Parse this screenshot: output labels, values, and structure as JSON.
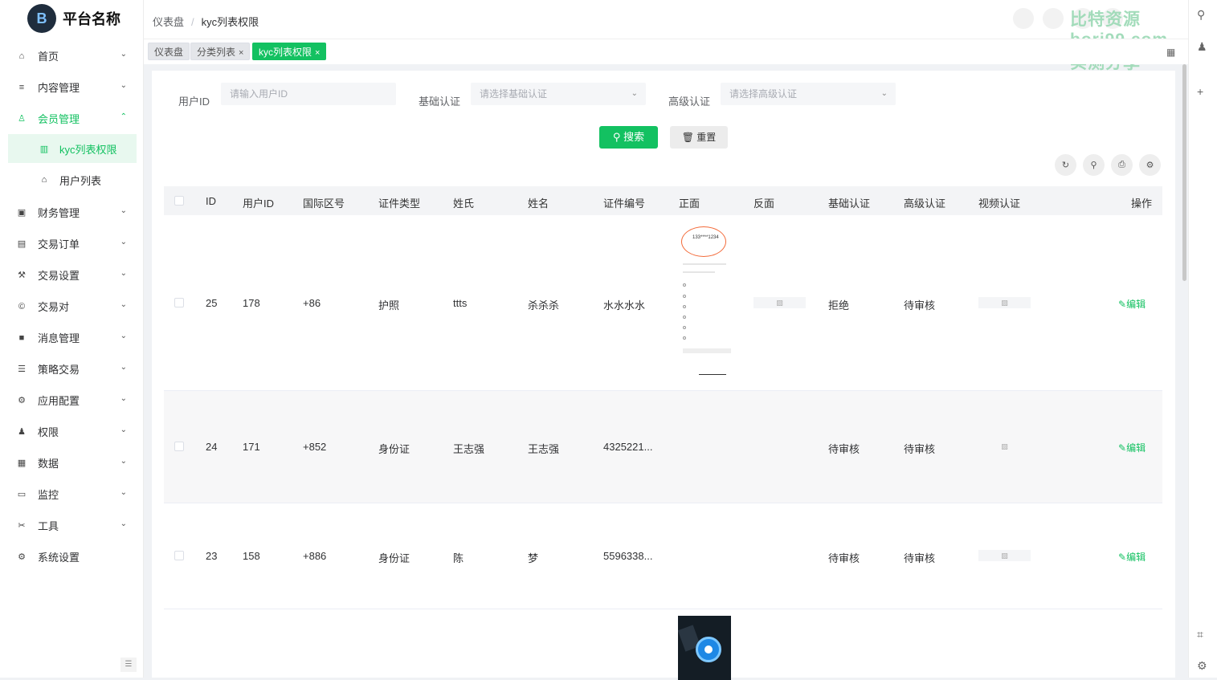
{
  "app": {
    "name": "平台名称",
    "logo_letter": "B"
  },
  "breadcrumb": {
    "items": [
      "仪表盘",
      "kyc列表权限"
    ],
    "separator": "/"
  },
  "watermark": "比特资源 bori99.com 实测分享",
  "tags": [
    {
      "label": "仪表盘",
      "closable": false,
      "active": false
    },
    {
      "label": "分类列表",
      "closable": true,
      "active": false
    },
    {
      "label": "kyc列表权限",
      "closable": true,
      "active": true
    }
  ],
  "close_glyph": "×",
  "sidebar": {
    "items": [
      {
        "label": "首页",
        "icon": "home-icon",
        "glyph": "⌂",
        "expanded": false
      },
      {
        "label": "内容管理",
        "icon": "list-icon",
        "glyph": "≡",
        "expanded": false
      },
      {
        "label": "会员管理",
        "icon": "user-icon",
        "glyph": "♙",
        "expanded": true,
        "active": true
      },
      {
        "label": "财务管理",
        "icon": "wallet-icon",
        "glyph": "▣",
        "expanded": false
      },
      {
        "label": "交易订单",
        "icon": "order-icon",
        "glyph": "▤",
        "expanded": false
      },
      {
        "label": "交易设置",
        "icon": "wrench-icon",
        "glyph": "⚒",
        "expanded": false
      },
      {
        "label": "交易对",
        "icon": "coin-icon",
        "glyph": "©",
        "expanded": false
      },
      {
        "label": "消息管理",
        "icon": "message-icon",
        "glyph": "■",
        "expanded": false
      },
      {
        "label": "策略交易",
        "icon": "menu-icon",
        "glyph": "☰",
        "expanded": false
      },
      {
        "label": "应用配置",
        "icon": "app-config-icon",
        "glyph": "⚙",
        "expanded": false
      },
      {
        "label": "权限",
        "icon": "permission-icon",
        "glyph": "♟",
        "expanded": false
      },
      {
        "label": "数据",
        "icon": "data-icon",
        "glyph": "▦",
        "expanded": false
      },
      {
        "label": "监控",
        "icon": "monitor-icon",
        "glyph": "▭",
        "expanded": false
      },
      {
        "label": "工具",
        "icon": "tools-icon",
        "glyph": "✂",
        "expanded": false
      },
      {
        "label": "系统设置",
        "icon": "settings-icon",
        "glyph": "⚙",
        "expanded": null
      }
    ],
    "sub_items": [
      {
        "label": "kyc列表权限",
        "icon": "book-icon",
        "glyph": "▥",
        "selected": true
      },
      {
        "label": "用户列表",
        "icon": "home-icon",
        "glyph": "⌂",
        "selected": false
      }
    ],
    "chevron_down": "⌄",
    "chevron_up": "⌃",
    "collapse_glyph": "☰"
  },
  "filters": {
    "user_id": {
      "label": "用户ID",
      "placeholder": "请输入用户ID"
    },
    "basic_auth": {
      "label": "基础认证",
      "placeholder": "请选择基础认证"
    },
    "advanced_auth": {
      "label": "高级认证",
      "placeholder": "请选择高级认证"
    },
    "dropdown_glyph": "⌄"
  },
  "buttons": {
    "search": "搜索",
    "reset": "重置",
    "search_glyph": "⚲",
    "reset_glyph": "🗑"
  },
  "toolbar_icons": [
    {
      "name": "refresh-icon",
      "glyph": "↻"
    },
    {
      "name": "search-icon",
      "glyph": "⚲"
    },
    {
      "name": "print-icon",
      "glyph": "⎙"
    },
    {
      "name": "settings-icon",
      "glyph": "⚙"
    }
  ],
  "table": {
    "headers": [
      "ID",
      "用户ID",
      "国际区号",
      "证件类型",
      "姓氏",
      "姓名",
      "证件编号",
      "正面",
      "反面",
      "基础认证",
      "高级认证",
      "视频认证",
      "操作"
    ],
    "rows": [
      {
        "id": "25",
        "user_id": "178",
        "area_code": "+86",
        "doc_type": "护照",
        "surname": "ttts",
        "name": "杀杀杀",
        "doc_no": "水水水水",
        "front": "phone-screenshot",
        "back": "placeholder",
        "basic": "拒绝",
        "advanced": "待审核",
        "video": "placeholder",
        "action": "编辑"
      },
      {
        "id": "24",
        "user_id": "171",
        "area_code": "+852",
        "doc_type": "身份证",
        "surname": "王志强",
        "name": "王志强",
        "doc_no": "4325221...",
        "front": "",
        "back": "",
        "basic": "待审核",
        "advanced": "待审核",
        "video": "placeholder",
        "action": "编辑"
      },
      {
        "id": "23",
        "user_id": "158",
        "area_code": "+886",
        "doc_type": "身份证",
        "surname": "陈",
        "name": "梦",
        "doc_no": "5596338...",
        "front": "",
        "back": "",
        "basic": "待审核",
        "advanced": "待审核",
        "video": "placeholder",
        "action": "编辑"
      }
    ],
    "edit_glyph": "✎"
  },
  "phone_shot": {
    "line1": "133****1234"
  },
  "image_placeholder_glyph": "▨",
  "colors": {
    "accent": "#13c161",
    "sidebar_bg": "#ffffff",
    "page_bg": "#f0f2f5"
  }
}
